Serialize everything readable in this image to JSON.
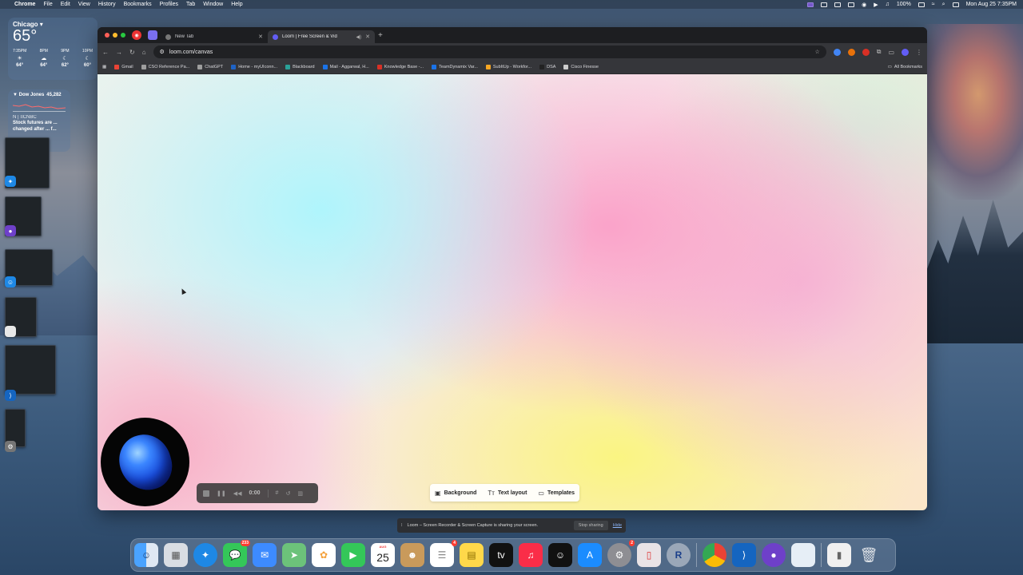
{
  "menubar": {
    "app": "Chrome",
    "items": [
      "File",
      "Edit",
      "View",
      "History",
      "Bookmarks",
      "Profiles",
      "Tab",
      "Window",
      "Help"
    ],
    "battery": "100%",
    "datetime": "Mon Aug 25  7:35PM"
  },
  "weather": {
    "city": "Chicago ▾",
    "temp": "65°",
    "hours": [
      {
        "time": "7:35PM",
        "icon": "sun-icon",
        "temp": "64°"
      },
      {
        "time": "8PM",
        "icon": "cloud-icon",
        "temp": "64°"
      },
      {
        "time": "9PM",
        "icon": "moon-icon",
        "temp": "62°"
      },
      {
        "time": "10PM",
        "icon": "moon-icon",
        "temp": "60°"
      }
    ]
  },
  "stocks": {
    "name": "▼ Dow Jones",
    "value": "45,282",
    "source": "N | ≡CNBC",
    "news": "Stock futures are ... changed after ... f..."
  },
  "browser": {
    "tabs": [
      {
        "title": "New Tab",
        "active": false
      },
      {
        "title": "Loom | Free Screen & Vid",
        "active": true
      }
    ],
    "url": "loom.com/canvas",
    "bookmarks": [
      {
        "label": "Gmail",
        "color": "#ea4335"
      },
      {
        "label": "CSO Reference Pa...",
        "color": "#9e9e9e"
      },
      {
        "label": "ChatGPT",
        "color": "#9e9e9e"
      },
      {
        "label": "Home - myUIconn...",
        "color": "#1e63c6"
      },
      {
        "label": "Blackboard",
        "color": "#2aa198"
      },
      {
        "label": "Mail - Aggarwal, H...",
        "color": "#1a73e8"
      },
      {
        "label": "Knowledge Base -...",
        "color": "#d93025"
      },
      {
        "label": "TeamDynamix Var...",
        "color": "#1a73e8"
      },
      {
        "label": "SubItUp - Workfor...",
        "color": "#f6a623"
      },
      {
        "label": "DSA",
        "color": "#222222"
      },
      {
        "label": "Cisco Finesse",
        "color": "#cccccc"
      }
    ],
    "all_bookmarks": "All Bookmarks"
  },
  "canvas": {
    "timer": "0:00",
    "menu": [
      {
        "icon": "image-icon",
        "label": "Background"
      },
      {
        "icon": "text-layout-icon",
        "label": "Text layout"
      },
      {
        "icon": "templates-icon",
        "label": "Templates"
      }
    ]
  },
  "share_bar": {
    "message": "Loom – Screen Recorder & Screen Capture is sharing your screen.",
    "stop": "Stop sharing",
    "hide": "Hide"
  },
  "dock": {
    "messages_badge": "233",
    "calendar_month": "AUG",
    "calendar_day": "25",
    "reminders_badge": "4",
    "settings_badge": "2"
  },
  "colors": {
    "accent": "#625df5",
    "chrome_dark": "#35363a"
  }
}
